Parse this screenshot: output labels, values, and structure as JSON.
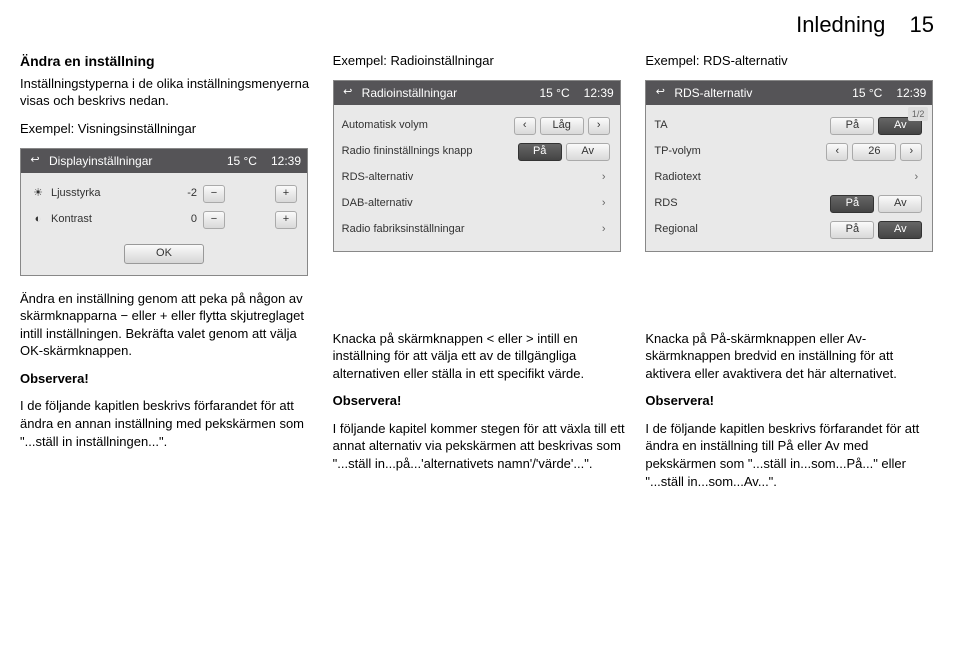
{
  "header": {
    "section": "Inledning",
    "page": "15"
  },
  "col1": {
    "h": "Ändra en inställning",
    "p1": "Inställningstyperna i de olika inställningsmenyerna visas och beskrivs nedan.",
    "p2": "Exempel: Visningsinställningar",
    "p3": "Ändra en inställning genom att peka på någon av skärmknapparna − eller + eller flytta skjutreglaget intill inställningen. Bekräfta valet genom att välja OK-skärmknappen.",
    "obs": "Observera!",
    "p4": "I de följande kapitlen beskrivs förfarandet för att ändra en annan inställning med pekskärmen som \"...ställ in inställningen...\"."
  },
  "col2": {
    "h": "Exempel: Radioinställningar",
    "p1a": "Knacka på skärmknappen ",
    "p1b": " eller ",
    "p1c": " intill en inställning för att välja ett av de tillgängliga alternativen eller ställa in ett specifikt värde.",
    "lt": "<",
    "gt": ">",
    "obs": "Observera!",
    "p2": "I följande kapitel kommer stegen för att växla till ett annat alternativ via pekskärmen att beskrivas som \"...ställ in...på...'alternativets namn'/'värde'...\"."
  },
  "col3": {
    "h": "Exempel: RDS-alternativ",
    "p1": "Knacka på På-skärmknappen eller Av-skärmknappen bredvid en inställning för att aktivera eller avaktivera det här alternativet.",
    "obs": "Observera!",
    "p2": "I de följande kapitlen beskrivs förfarandet för att ändra en inställning till På eller Av med pekskärmen som \"...ställ in...som...På...\" eller \"...ställ in...som...Av...\"."
  },
  "screenA": {
    "title": "Displayinställningar",
    "temp": "15 °C",
    "clock": "12:39",
    "rows": [
      {
        "icon": "☀",
        "label": "Ljusstyrka",
        "val": "-2",
        "minus": "−",
        "plus": "+"
      },
      {
        "icon": "◐",
        "label": "Kontrast",
        "val": "0",
        "minus": "−",
        "plus": "+"
      }
    ],
    "ok": "OK"
  },
  "screenB": {
    "title": "Radioinställningar",
    "temp": "15 °C",
    "clock": "12:39",
    "rows": [
      {
        "label": "Automatisk volym",
        "type": "stepper",
        "val": "Låg"
      },
      {
        "label": "Radio fininställnings knapp",
        "type": "toggle",
        "on": "På",
        "off": "Av"
      },
      {
        "label": "RDS-alternativ",
        "type": "arrow"
      },
      {
        "label": "DAB-alternativ",
        "type": "arrow"
      },
      {
        "label": "Radio fabriksinställningar",
        "type": "arrow"
      }
    ]
  },
  "screenC": {
    "title": "RDS-alternativ",
    "temp": "15 °C",
    "clock": "12:39",
    "pager": "1/2",
    "rows": [
      {
        "label": "TA",
        "type": "toggle",
        "on": "På",
        "off": "Av"
      },
      {
        "label": "TP-volym",
        "type": "stepper",
        "val": "26"
      },
      {
        "label": "Radiotext",
        "type": "arrow"
      },
      {
        "label": "RDS",
        "type": "toggle",
        "on": "På",
        "off": "Av"
      },
      {
        "label": "Regional",
        "type": "toggle",
        "on": "På",
        "off": "Av"
      }
    ]
  }
}
